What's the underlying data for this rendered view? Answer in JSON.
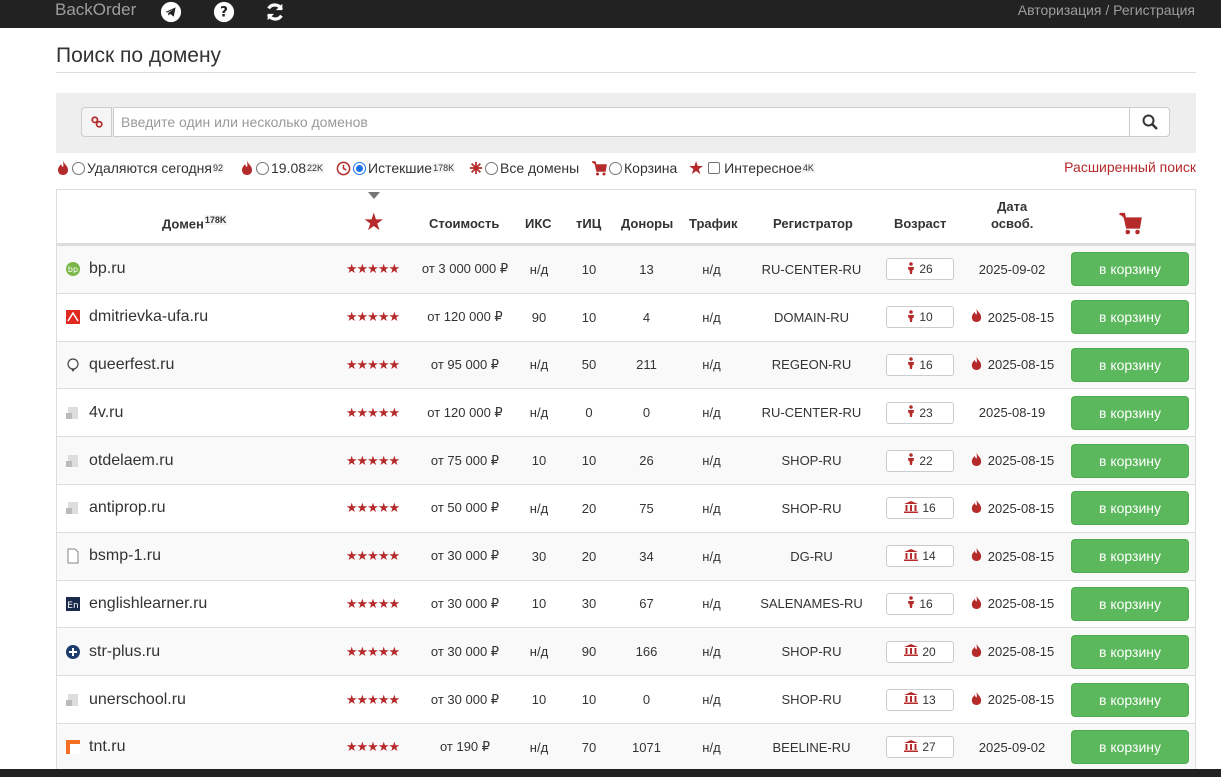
{
  "navbar": {
    "brand": "BackOrder",
    "auth": "Авторизация / Регистрация"
  },
  "page": {
    "title": "Поиск по домену"
  },
  "search": {
    "placeholder": "Введите один или несколько доменов"
  },
  "filters": {
    "deleting_today": {
      "label": "Удаляются сегодня",
      "count": "92"
    },
    "date": {
      "label": "19.08",
      "count": "22K"
    },
    "expiring": {
      "label": "Истекшие",
      "count": "178K"
    },
    "all_domains": {
      "label": "Все домены"
    },
    "cart": {
      "label": "Корзина"
    },
    "interesting": {
      "label": "Интересное",
      "count": "4K"
    },
    "advanced": "Расширенный поиск"
  },
  "table": {
    "headers": {
      "domain": "Домен",
      "domain_count": "178K",
      "price": "Стоимость",
      "iks": "ИКС",
      "tic": "тИЦ",
      "donors": "Доноры",
      "traffic": "Трафик",
      "registrar": "Регистратор",
      "age": "Возраст",
      "date_line1": "Дата",
      "date_line2": "освоб."
    },
    "cart_label": "в корзину",
    "rows": [
      {
        "domain": "bp.ru",
        "rating": "★★★★★",
        "price": "от 3 000 000 ₽",
        "iks": "н/д",
        "tic": "10",
        "donors": "13",
        "traffic": "н/д",
        "registrar": "RU-CENTER-RU",
        "age": "26",
        "date": "2025-09-02"
      },
      {
        "domain": "dmitrievka-ufa.ru",
        "rating": "★★★★★",
        "price": "от 120 000 ₽",
        "iks": "90",
        "tic": "10",
        "donors": "4",
        "traffic": "н/д",
        "registrar": "DOMAIN-RU",
        "age": "10",
        "date": "2025-08-15"
      },
      {
        "domain": "queerfest.ru",
        "rating": "★★★★★",
        "price": "от 95 000 ₽",
        "iks": "н/д",
        "tic": "50",
        "donors": "211",
        "traffic": "н/д",
        "registrar": "REGEON-RU",
        "age": "16",
        "date": "2025-08-15"
      },
      {
        "domain": "4v.ru",
        "rating": "★★★★★",
        "price": "от 120 000 ₽",
        "iks": "н/д",
        "tic": "0",
        "donors": "0",
        "traffic": "н/д",
        "registrar": "RU-CENTER-RU",
        "age": "23",
        "date": "2025-08-19"
      },
      {
        "domain": "otdelaem.ru",
        "rating": "★★★★★",
        "price": "от 75 000 ₽",
        "iks": "10",
        "tic": "10",
        "donors": "26",
        "traffic": "н/д",
        "registrar": "SHOP-RU",
        "age": "22",
        "date": "2025-08-15"
      },
      {
        "domain": "antiprop.ru",
        "rating": "★★★★★",
        "price": "от 50 000 ₽",
        "iks": "н/д",
        "tic": "20",
        "donors": "75",
        "traffic": "н/д",
        "registrar": "SHOP-RU",
        "age": "16",
        "date": "2025-08-15"
      },
      {
        "domain": "bsmp-1.ru",
        "rating": "★★★★★",
        "price": "от 30 000 ₽",
        "iks": "30",
        "tic": "20",
        "donors": "34",
        "traffic": "н/д",
        "registrar": "DG-RU",
        "age": "14",
        "date": "2025-08-15"
      },
      {
        "domain": "englishlearner.ru",
        "rating": "★★★★★",
        "price": "от 30 000 ₽",
        "iks": "10",
        "tic": "30",
        "donors": "67",
        "traffic": "н/д",
        "registrar": "SALENAMES-RU",
        "age": "16",
        "date": "2025-08-15"
      },
      {
        "domain": "str-plus.ru",
        "rating": "★★★★★",
        "price": "от 30 000 ₽",
        "iks": "н/д",
        "tic": "90",
        "donors": "166",
        "traffic": "н/д",
        "registrar": "SHOP-RU",
        "age": "20",
        "date": "2025-08-15"
      },
      {
        "domain": "unerschool.ru",
        "rating": "★★★★★",
        "price": "от 30 000 ₽",
        "iks": "10",
        "tic": "10",
        "donors": "0",
        "traffic": "н/д",
        "registrar": "SHOP-RU",
        "age": "13",
        "date": "2025-08-15"
      },
      {
        "domain": "tnt.ru",
        "rating": "★★★★★",
        "price": "от 190 ₽",
        "iks": "н/д",
        "tic": "70",
        "donors": "1071",
        "traffic": "н/д",
        "registrar": "BEELINE-RU",
        "age": "27",
        "date": "2025-09-02"
      }
    ]
  },
  "colors": {
    "accent_red": "#b52a2a",
    "cart_green": "#5cb85c",
    "navbar": "#222222"
  }
}
